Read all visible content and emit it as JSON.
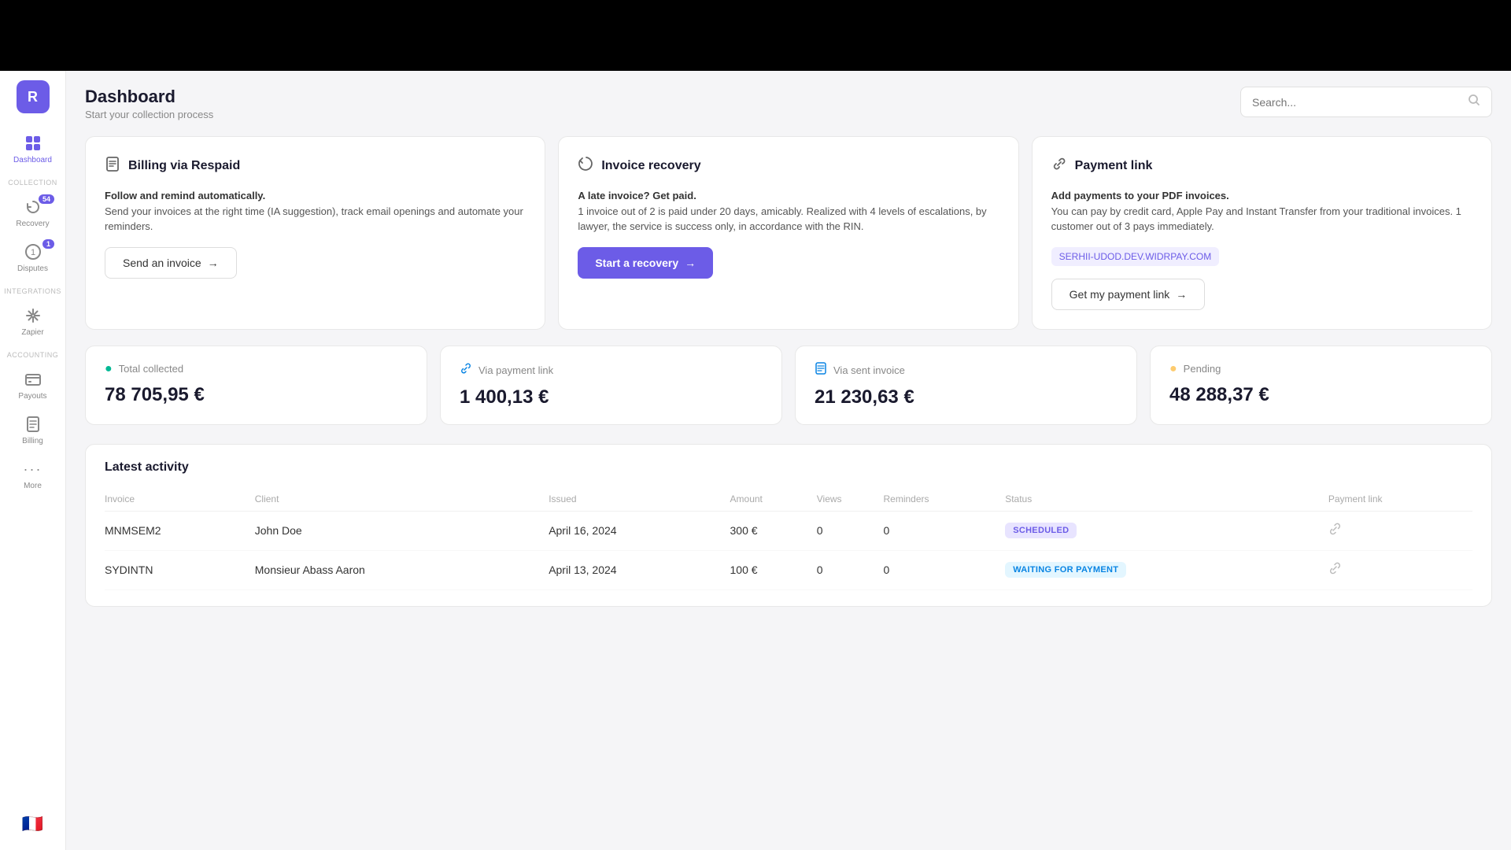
{
  "app": {
    "logo": "R",
    "logo_color": "#6c5ce7"
  },
  "sidebar": {
    "section_collection": "COLLECTION",
    "section_integrations": "INTEGRATIONS",
    "section_accounting": "ACCOUNTING",
    "items": [
      {
        "id": "dashboard",
        "label": "Dashboard",
        "icon": "⊞",
        "active": true,
        "badge": null
      },
      {
        "id": "recovery",
        "label": "Recovery",
        "icon": "↩",
        "active": false,
        "badge": "54"
      },
      {
        "id": "disputes",
        "label": "Disputes",
        "icon": "①",
        "active": false,
        "badge": "1"
      },
      {
        "id": "zapier",
        "label": "Zapier",
        "icon": "⚡",
        "active": false,
        "badge": null
      },
      {
        "id": "payouts",
        "label": "Payouts",
        "icon": "💳",
        "active": false,
        "badge": null
      },
      {
        "id": "billing",
        "label": "Billing",
        "icon": "🧾",
        "active": false,
        "badge": null
      },
      {
        "id": "more",
        "label": "More",
        "icon": "···",
        "active": false,
        "badge": null
      }
    ],
    "flag": "🇫🇷"
  },
  "header": {
    "title": "Dashboard",
    "subtitle": "Start your collection process",
    "search_placeholder": "Search..."
  },
  "cards": [
    {
      "id": "billing",
      "icon": "📄",
      "title": "Billing via Respaid",
      "description": "Follow and remind automatically.",
      "detail": "Send your invoices at the right time (IA suggestion), track email openings and automate your reminders.",
      "button_label": "Send an invoice",
      "button_type": "outline"
    },
    {
      "id": "recovery",
      "icon": "📁",
      "title": "Invoice recovery",
      "description": "A late invoice? Get paid.",
      "detail": "1 invoice out of 2 is paid under 20 days, amicably. Realized with 4 levels of escalations, by lawyer, the service is success only, in accordance with the RIN.",
      "button_label": "Start a recovery",
      "button_type": "primary"
    },
    {
      "id": "payment-link",
      "icon": "🔗",
      "title": "Payment link",
      "description": "Add payments to your PDF invoices.",
      "detail": "You can pay by credit card, Apple Pay and Instant Transfer from your traditional invoices. 1 customer out of 3 pays immediately.",
      "link": "SERHII-UDOD.DEV.WIDRPAY.COM",
      "button_label": "Get my payment link",
      "button_type": "outline"
    }
  ],
  "stats": [
    {
      "id": "total-collected",
      "icon": "🟢",
      "icon_color": "green",
      "label": "Total collected",
      "value": "78 705,95 €"
    },
    {
      "id": "via-payment-link",
      "icon": "🔗",
      "icon_color": "blue",
      "label": "Via payment link",
      "value": "1 400,13 €"
    },
    {
      "id": "via-sent-invoice",
      "icon": "📄",
      "icon_color": "blue",
      "label": "Via sent invoice",
      "value": "21 230,63 €"
    },
    {
      "id": "pending",
      "icon": "🟡",
      "icon_color": "yellow",
      "label": "Pending",
      "value": "48 288,37 €"
    }
  ],
  "activity": {
    "title": "Latest activity",
    "columns": [
      "Invoice",
      "Client",
      "Issued",
      "Amount",
      "Views",
      "Reminders",
      "Status",
      "Payment link"
    ],
    "rows": [
      {
        "invoice": "MNMSEM2",
        "client": "John Doe",
        "issued": "April 16, 2024",
        "amount": "300 €",
        "views": "0",
        "reminders": "0",
        "status": "SCHEDULED",
        "status_type": "scheduled",
        "has_link": true
      },
      {
        "invoice": "SYDINTN",
        "client": "Monsieur Abass Aaron",
        "issued": "April 13, 2024",
        "amount": "100 €",
        "views": "0",
        "reminders": "0",
        "status": "WAITING FOR PAYMENT",
        "status_type": "waiting",
        "has_link": true
      }
    ]
  }
}
